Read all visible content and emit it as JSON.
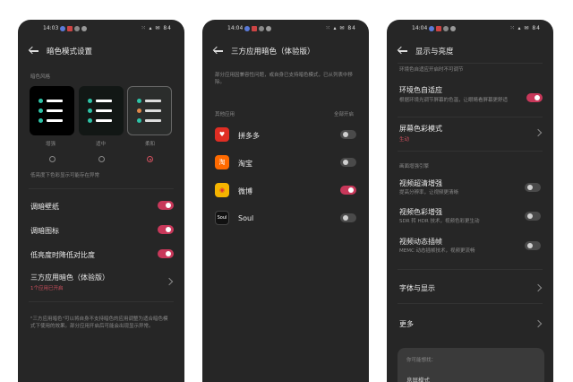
{
  "screen1": {
    "status": {
      "time": "14:03",
      "right": "⁙ ▴ ✉ 84"
    },
    "title": "暗色模式设置",
    "style_label": "暗色风格",
    "themes": [
      {
        "label": "增强",
        "bg": "#000000",
        "selected": false
      },
      {
        "label": "适中",
        "bg": "#151a18",
        "selected": false
      },
      {
        "label": "柔和",
        "bg": "#2b2d2c",
        "selected": true
      }
    ],
    "note": "低亮度下色彩显示可能存在异常",
    "settings": [
      {
        "label": "调暗壁纸",
        "on": true
      },
      {
        "label": "调暗图标",
        "on": true
      },
      {
        "label": "低亮度时降低对比度",
        "on": true
      }
    ],
    "third_party": {
      "label": "三方应用暗色（体验版）",
      "sub": "1个应用已开启"
    },
    "footnote": "\"三方应用暗色\"可以将自身不支持暗色的应用调整为适合暗色模式下使用的效果。部分应用开启后可能会出现显示异常。"
  },
  "screen2": {
    "status": {
      "time": "14:04",
      "right": "⁙ ▴ ✉ 84"
    },
    "title": "三方应用暗色（体验版）",
    "desc": "部分应用因兼容性问题，或自身已支持暗色模式，已从列表中移除。",
    "section": "其他应用",
    "all_label": "全部开启",
    "apps": [
      {
        "name": "拼多多",
        "icon": "pinduoduo-icon",
        "color": "#e02e24",
        "glyph": "♥",
        "on": false
      },
      {
        "name": "淘宝",
        "icon": "taobao-icon",
        "color": "#ff6a00",
        "glyph": "淘",
        "on": false
      },
      {
        "name": "微博",
        "icon": "weibo-icon",
        "color": "#f5b400",
        "glyph": "◉",
        "on": true
      },
      {
        "name": "Soul",
        "icon": "soul-icon",
        "color": "#111111",
        "glyph": "Soul",
        "on": false
      }
    ]
  },
  "screen3": {
    "status": {
      "time": "14:04",
      "right": "⁙ ▴ ✉ 84"
    },
    "title": "显示与亮度",
    "top_note": "环境色自适应开启时不可调节",
    "adaptive": {
      "label": "环境色自适应",
      "sub": "根据环境光调节屏幕的色温，让眼睛看屏幕更舒适",
      "on": true
    },
    "color_mode": {
      "label": "屏幕色彩模式",
      "sub": "生动"
    },
    "engine_label": "画面增强引擎",
    "engine": [
      {
        "label": "视频超清增强",
        "sub": "提高分辨率，让视频更清晰",
        "on": false
      },
      {
        "label": "视频色彩增强",
        "sub": "SDR 转 HDR 技术，视频色彩更生动",
        "on": false
      },
      {
        "label": "视频动态插帧",
        "sub": "MEMC 动态插帧技术，视频更流畅",
        "on": false
      }
    ],
    "font": "字体与显示",
    "more": "更多",
    "card_title": "你可能想找：",
    "card_item": "息屏模式"
  },
  "colors": {
    "accent": "#c8385a",
    "panel": "#262626"
  }
}
